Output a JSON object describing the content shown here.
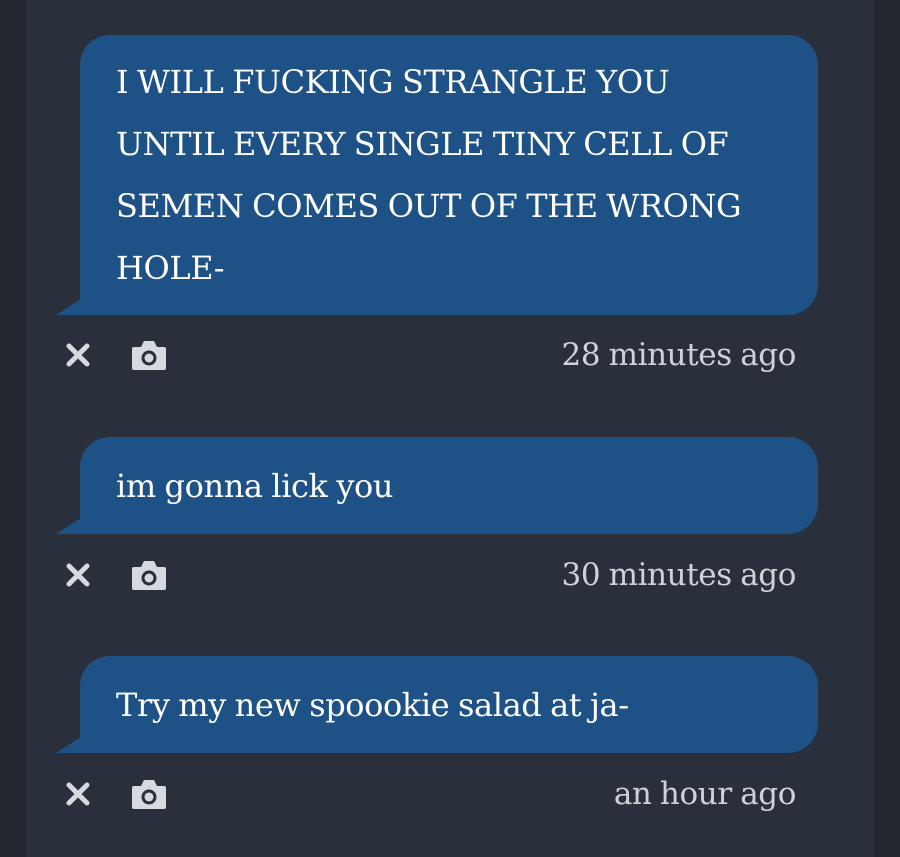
{
  "messages": [
    {
      "text": "I WILL FUCKING STRANGLE YOU UNTIL EVERY SINGLE TINY CELL OF SEMEN COMES OUT OF THE WRONG HOLE-",
      "time": "28 minutes ago"
    },
    {
      "text": "im gonna lick you",
      "time": "30 minutes ago"
    },
    {
      "text": "Try my new spoookie salad at ja-",
      "time": "an hour ago"
    }
  ],
  "icons": {
    "dismiss": "close-icon",
    "screenshot": "camera-icon"
  },
  "colors": {
    "background": "#2a303b",
    "bubble": "#1e5186",
    "bubble_text": "#ffffff",
    "meta_text": "#cfd3d9",
    "icon": "#d6d9de"
  }
}
